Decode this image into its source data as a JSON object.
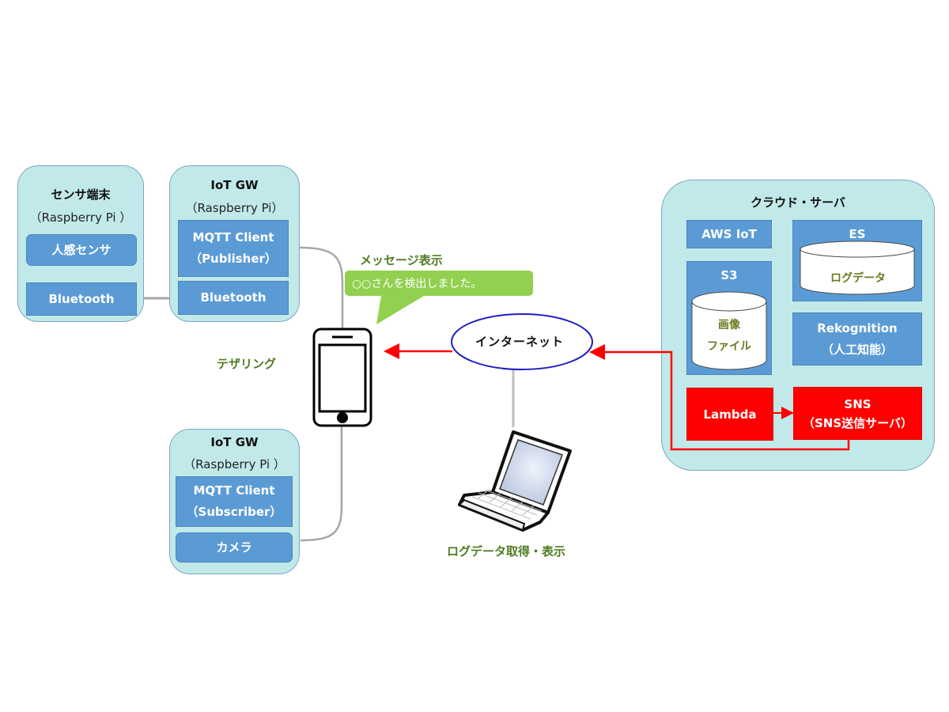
{
  "sensor_terminal": {
    "title": "センサ端末",
    "subtitle": "（Raspberry Pi ）",
    "modules": [
      "人感センサ",
      "Bluetooth"
    ]
  },
  "iot_gw_publisher": {
    "title": "IoT GW",
    "subtitle": "（Raspberry Pi）",
    "client_line1": "MQTT  Client",
    "client_line2": "（Publisher）",
    "bluetooth": "Bluetooth"
  },
  "iot_gw_subscriber": {
    "title": "IoT GW",
    "subtitle": "（Raspberry Pi ）",
    "client_line1": "MQTT  Client",
    "client_line2": "（Subscriber）",
    "camera": "カメラ"
  },
  "smartphone": {
    "tethering_label": "テザリング",
    "message_label": "メッセージ表示",
    "message_text": "○○さんを検出しました。"
  },
  "internet": {
    "label": "インターネット"
  },
  "laptop": {
    "label": "ログデータ取得・表示"
  },
  "cloud": {
    "title": "クラウド・サーバ",
    "aws_iot": "AWS IoT",
    "es": {
      "title": "ES",
      "storage": "ログデータ"
    },
    "s3": {
      "title": "S3",
      "storage_line1": "画像",
      "storage_line2": "ファイル"
    },
    "rekognition": {
      "line1": "Rekognition",
      "line2": "（人工知能）"
    },
    "lambda": "Lambda",
    "sns": {
      "line1": "SNS",
      "line2": "（SNS送信サーバ）"
    }
  },
  "colors": {
    "container_fill": "#c2e9e9",
    "module_blue": "#5b9bd5",
    "alert_red": "#ff0000",
    "label_green": "#4f7c23",
    "bubble_green": "#92d050",
    "internet_outline": "#1f1fbf"
  }
}
